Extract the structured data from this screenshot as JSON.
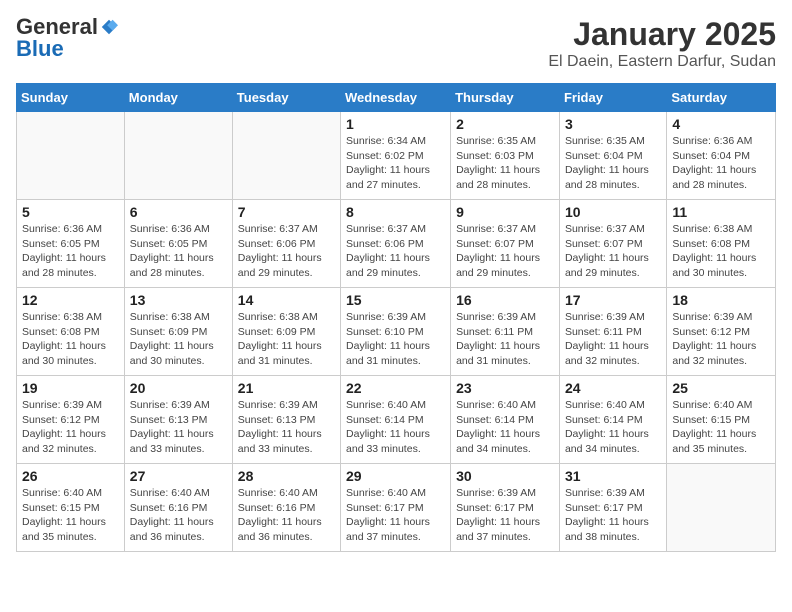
{
  "header": {
    "logo_general": "General",
    "logo_blue": "Blue",
    "title": "January 2025",
    "subtitle": "El Daein, Eastern Darfur, Sudan"
  },
  "days_of_week": [
    "Sunday",
    "Monday",
    "Tuesday",
    "Wednesday",
    "Thursday",
    "Friday",
    "Saturday"
  ],
  "weeks": [
    [
      {
        "day": "",
        "info": ""
      },
      {
        "day": "",
        "info": ""
      },
      {
        "day": "",
        "info": ""
      },
      {
        "day": "1",
        "info": "Sunrise: 6:34 AM\nSunset: 6:02 PM\nDaylight: 11 hours and 27 minutes."
      },
      {
        "day": "2",
        "info": "Sunrise: 6:35 AM\nSunset: 6:03 PM\nDaylight: 11 hours and 28 minutes."
      },
      {
        "day": "3",
        "info": "Sunrise: 6:35 AM\nSunset: 6:04 PM\nDaylight: 11 hours and 28 minutes."
      },
      {
        "day": "4",
        "info": "Sunrise: 6:36 AM\nSunset: 6:04 PM\nDaylight: 11 hours and 28 minutes."
      }
    ],
    [
      {
        "day": "5",
        "info": "Sunrise: 6:36 AM\nSunset: 6:05 PM\nDaylight: 11 hours and 28 minutes."
      },
      {
        "day": "6",
        "info": "Sunrise: 6:36 AM\nSunset: 6:05 PM\nDaylight: 11 hours and 28 minutes."
      },
      {
        "day": "7",
        "info": "Sunrise: 6:37 AM\nSunset: 6:06 PM\nDaylight: 11 hours and 29 minutes."
      },
      {
        "day": "8",
        "info": "Sunrise: 6:37 AM\nSunset: 6:06 PM\nDaylight: 11 hours and 29 minutes."
      },
      {
        "day": "9",
        "info": "Sunrise: 6:37 AM\nSunset: 6:07 PM\nDaylight: 11 hours and 29 minutes."
      },
      {
        "day": "10",
        "info": "Sunrise: 6:37 AM\nSunset: 6:07 PM\nDaylight: 11 hours and 29 minutes."
      },
      {
        "day": "11",
        "info": "Sunrise: 6:38 AM\nSunset: 6:08 PM\nDaylight: 11 hours and 30 minutes."
      }
    ],
    [
      {
        "day": "12",
        "info": "Sunrise: 6:38 AM\nSunset: 6:08 PM\nDaylight: 11 hours and 30 minutes."
      },
      {
        "day": "13",
        "info": "Sunrise: 6:38 AM\nSunset: 6:09 PM\nDaylight: 11 hours and 30 minutes."
      },
      {
        "day": "14",
        "info": "Sunrise: 6:38 AM\nSunset: 6:09 PM\nDaylight: 11 hours and 31 minutes."
      },
      {
        "day": "15",
        "info": "Sunrise: 6:39 AM\nSunset: 6:10 PM\nDaylight: 11 hours and 31 minutes."
      },
      {
        "day": "16",
        "info": "Sunrise: 6:39 AM\nSunset: 6:11 PM\nDaylight: 11 hours and 31 minutes."
      },
      {
        "day": "17",
        "info": "Sunrise: 6:39 AM\nSunset: 6:11 PM\nDaylight: 11 hours and 32 minutes."
      },
      {
        "day": "18",
        "info": "Sunrise: 6:39 AM\nSunset: 6:12 PM\nDaylight: 11 hours and 32 minutes."
      }
    ],
    [
      {
        "day": "19",
        "info": "Sunrise: 6:39 AM\nSunset: 6:12 PM\nDaylight: 11 hours and 32 minutes."
      },
      {
        "day": "20",
        "info": "Sunrise: 6:39 AM\nSunset: 6:13 PM\nDaylight: 11 hours and 33 minutes."
      },
      {
        "day": "21",
        "info": "Sunrise: 6:39 AM\nSunset: 6:13 PM\nDaylight: 11 hours and 33 minutes."
      },
      {
        "day": "22",
        "info": "Sunrise: 6:40 AM\nSunset: 6:14 PM\nDaylight: 11 hours and 33 minutes."
      },
      {
        "day": "23",
        "info": "Sunrise: 6:40 AM\nSunset: 6:14 PM\nDaylight: 11 hours and 34 minutes."
      },
      {
        "day": "24",
        "info": "Sunrise: 6:40 AM\nSunset: 6:14 PM\nDaylight: 11 hours and 34 minutes."
      },
      {
        "day": "25",
        "info": "Sunrise: 6:40 AM\nSunset: 6:15 PM\nDaylight: 11 hours and 35 minutes."
      }
    ],
    [
      {
        "day": "26",
        "info": "Sunrise: 6:40 AM\nSunset: 6:15 PM\nDaylight: 11 hours and 35 minutes."
      },
      {
        "day": "27",
        "info": "Sunrise: 6:40 AM\nSunset: 6:16 PM\nDaylight: 11 hours and 36 minutes."
      },
      {
        "day": "28",
        "info": "Sunrise: 6:40 AM\nSunset: 6:16 PM\nDaylight: 11 hours and 36 minutes."
      },
      {
        "day": "29",
        "info": "Sunrise: 6:40 AM\nSunset: 6:17 PM\nDaylight: 11 hours and 37 minutes."
      },
      {
        "day": "30",
        "info": "Sunrise: 6:39 AM\nSunset: 6:17 PM\nDaylight: 11 hours and 37 minutes."
      },
      {
        "day": "31",
        "info": "Sunrise: 6:39 AM\nSunset: 6:17 PM\nDaylight: 11 hours and 38 minutes."
      },
      {
        "day": "",
        "info": ""
      }
    ]
  ]
}
